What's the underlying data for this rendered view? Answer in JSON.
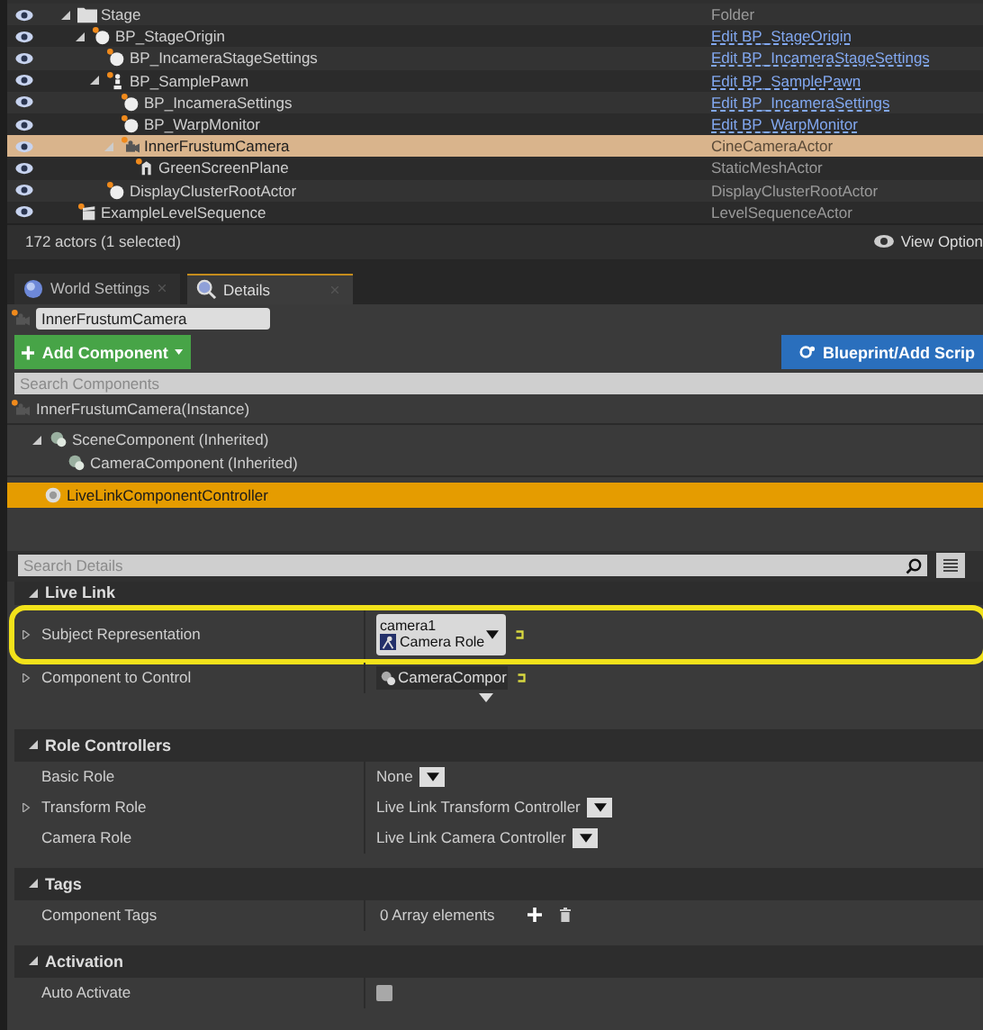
{
  "outliner": {
    "rows": [
      {
        "label": "Stage",
        "kind": "folder",
        "type": "Folder",
        "type_is_link": false,
        "expanded": true,
        "selected": false,
        "children": [
          {
            "label": "BP_StageOrigin",
            "kind": "sphere",
            "type": "Edit BP_StageOrigin",
            "type_is_link": true,
            "expanded": true,
            "selected": false,
            "children": [
              {
                "label": "BP_IncameraStageSettings",
                "kind": "sphere",
                "type": "Edit BP_IncameraStageSettings",
                "type_is_link": true,
                "selected": false
              },
              {
                "label": "BP_SamplePawn",
                "kind": "pawn",
                "type": "Edit BP_SamplePawn",
                "type_is_link": true,
                "expanded": true,
                "selected": false,
                "children": [
                  {
                    "label": "BP_IncameraSettings",
                    "kind": "sphere",
                    "type": "Edit BP_IncameraSettings",
                    "type_is_link": true,
                    "selected": false
                  },
                  {
                    "label": "BP_WarpMonitor",
                    "kind": "sphere",
                    "type": "Edit BP_WarpMonitor",
                    "type_is_link": true,
                    "selected": false
                  },
                  {
                    "label": "InnerFrustumCamera",
                    "kind": "camera",
                    "type": "CineCameraActor",
                    "type_is_link": false,
                    "expanded": true,
                    "selected": true,
                    "children": [
                      {
                        "label": "GreenScreenPlane",
                        "kind": "mesh",
                        "type": "StaticMeshActor",
                        "type_is_link": false,
                        "selected": false
                      }
                    ]
                  }
                ]
              },
              {
                "label": "DisplayClusterRootActor",
                "kind": "sphere",
                "type": "DisplayClusterRootActor",
                "type_is_link": false,
                "selected": false
              }
            ]
          }
        ]
      },
      {
        "label": "ExampleLevelSequence",
        "kind": "sequence",
        "type": "LevelSequenceActor",
        "type_is_link": false,
        "selected": false
      }
    ],
    "status": "172 actors (1 selected)",
    "view_options": "View Option"
  },
  "tabs": [
    {
      "label": "World Settings",
      "kind": "globe",
      "selected": false
    },
    {
      "label": "Details",
      "kind": "details",
      "selected": true
    }
  ],
  "details": {
    "actor_name": "InnerFrustumCamera",
    "add_component": "Add Component",
    "blueprint": "Blueprint/Add Scrip",
    "search_components_placeholder": "Search Components",
    "instance": "InnerFrustumCamera(Instance)",
    "components": [
      {
        "label": "SceneComponent (Inherited)",
        "expanded": true,
        "selected": false,
        "children": [
          {
            "label": "CameraComponent (Inherited)",
            "selected": false
          }
        ]
      }
    ],
    "extra_components": [
      {
        "label": "LiveLinkComponentController",
        "selected": true
      }
    ],
    "search_details_placeholder": "Search Details",
    "sections": [
      {
        "title": "Live Link",
        "expanded": true,
        "rows": [
          {
            "label": "Subject Representation",
            "kind": "subject",
            "expandable": true,
            "highlighted": true,
            "value": "camera1",
            "role": "Camera Role"
          },
          {
            "label": "Component to Control",
            "kind": "component",
            "expandable": true,
            "highlighted": false,
            "value": "CameraCompor"
          }
        ]
      },
      {
        "title": "Role Controllers",
        "expanded": true,
        "rows": [
          {
            "label": "Basic Role",
            "kind": "dropdown",
            "expandable": false,
            "value": "None"
          },
          {
            "label": "Transform Role",
            "kind": "dropdown",
            "expandable": true,
            "value": "Live Link Transform Controller"
          },
          {
            "label": "Camera Role",
            "kind": "dropdown",
            "expandable": false,
            "value": "Live Link Camera Controller"
          }
        ]
      },
      {
        "title": "Tags",
        "expanded": true,
        "rows": [
          {
            "label": "Component Tags",
            "kind": "array",
            "expandable": false,
            "value": "0 Array elements"
          }
        ]
      },
      {
        "title": "Activation",
        "expanded": true,
        "rows": [
          {
            "label": "Auto Activate",
            "kind": "checkbox",
            "expandable": false,
            "checked": false
          }
        ]
      }
    ]
  }
}
